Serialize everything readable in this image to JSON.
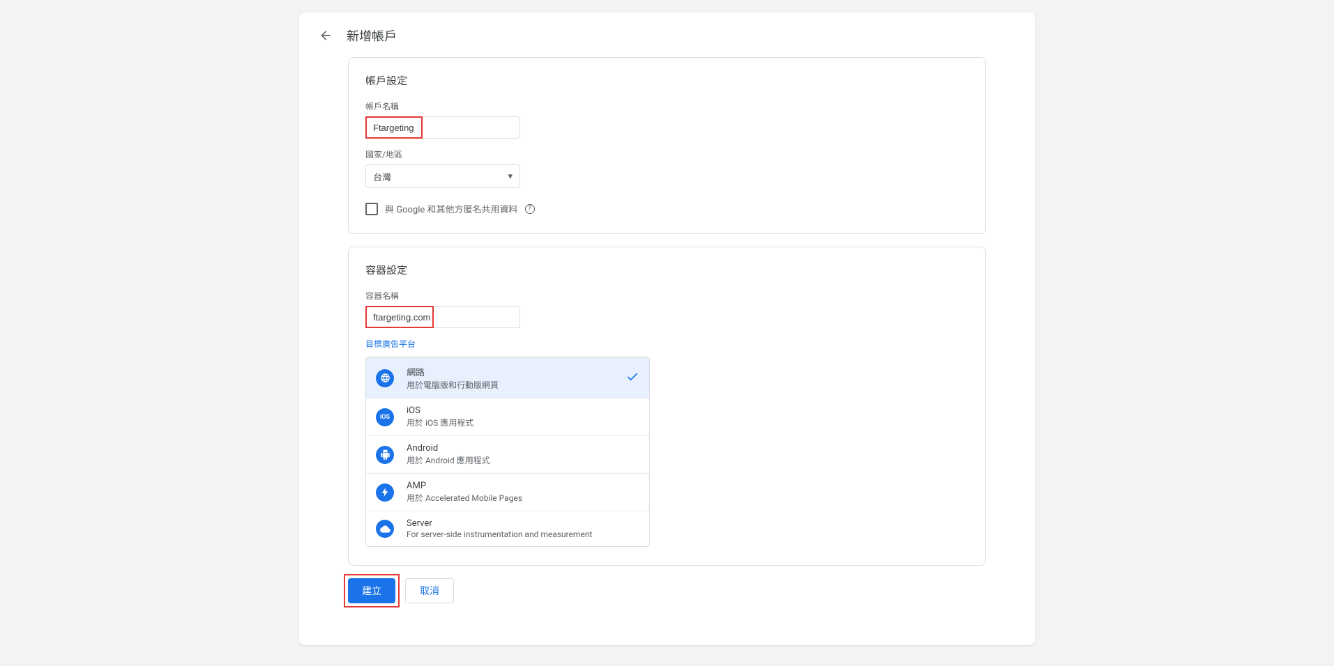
{
  "page": {
    "title": "新增帳戶"
  },
  "account": {
    "section_title": "帳戶設定",
    "name_label": "帳戶名稱",
    "name_value": "Ftargeting",
    "country_label": "國家/地區",
    "country_value": "台灣",
    "share_label": "與 Google 和其他方匿名共用資料"
  },
  "container": {
    "section_title": "容器設定",
    "name_label": "容器名稱",
    "name_value": "ftargeting.com",
    "platform_label": "目標廣告平台",
    "platforms": [
      {
        "name": "網路",
        "desc": "用於電腦版和行動版網頁",
        "selected": true,
        "icon": "globe"
      },
      {
        "name": "iOS",
        "desc": "用於 iOS 應用程式",
        "selected": false,
        "icon": "ios"
      },
      {
        "name": "Android",
        "desc": "用於 Android 應用程式",
        "selected": false,
        "icon": "android"
      },
      {
        "name": "AMP",
        "desc": "用於 Accelerated Mobile Pages",
        "selected": false,
        "icon": "amp"
      },
      {
        "name": "Server",
        "desc": "For server-side instrumentation and measurement",
        "selected": false,
        "icon": "server"
      }
    ]
  },
  "buttons": {
    "create": "建立",
    "cancel": "取消"
  }
}
